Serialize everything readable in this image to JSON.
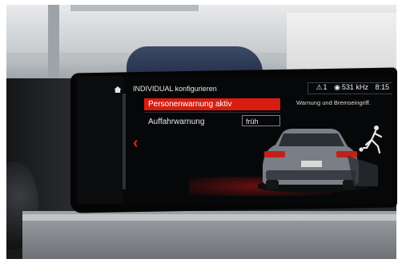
{
  "header": {
    "title": "INDIVIDUAL konfigurieren"
  },
  "status": {
    "warning_count": "1",
    "radio": "531 kHz",
    "time": "8:15"
  },
  "menu": {
    "items": [
      {
        "label": "Personenwarnung aktiv",
        "selected": true
      },
      {
        "label": "Auffahrwarnung",
        "value": "früh"
      }
    ]
  },
  "hint": "Warnung und Bremseingriff.",
  "icons": {
    "home": "home-icon",
    "back": "back-arrow-icon",
    "warning": "warning-triangle-icon",
    "radio": "radio-icon",
    "pedestrian": "pedestrian-icon",
    "car": "car-rear-icon"
  },
  "colors": {
    "accent": "#d81d10",
    "background": "#060708",
    "text": "#e7e7e7"
  }
}
